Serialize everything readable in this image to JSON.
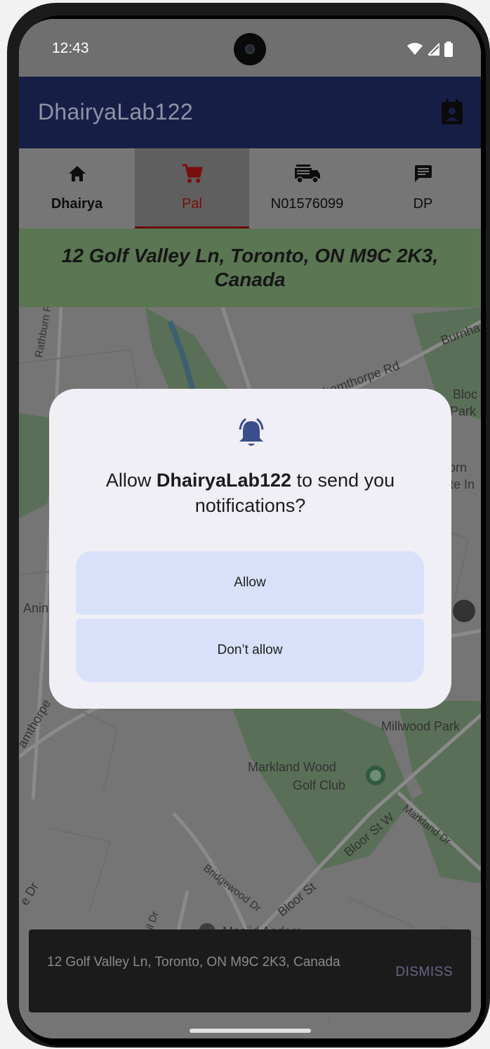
{
  "status_bar": {
    "time": "12:43"
  },
  "app_bar": {
    "title": "DhairyaLab122",
    "action_icon": "calendar-person-icon"
  },
  "tabs": [
    {
      "label": "Dhairya",
      "icon": "home-icon",
      "selected": false
    },
    {
      "label": "Pal",
      "icon": "shopping-cart-icon",
      "selected": true
    },
    {
      "label": "N01576099",
      "icon": "fire-truck-icon",
      "selected": false
    },
    {
      "label": "DP",
      "icon": "chat-icon",
      "selected": false
    }
  ],
  "address_banner": {
    "text": "12 Golf Valley Ln, Toronto, ON M9C 2K3, Canada"
  },
  "map": {
    "labels": {
      "rathburn": "Rathburn Rd E",
      "burnhamthorpe_top": "Burnhamthorpe Rd",
      "burnha": "Burnha",
      "bloor_park": "Bloc",
      "park": "Park",
      "orn": "orn",
      "ite_in": "ite In",
      "anim": "Anin",
      "millwood": "Millwood Park",
      "amthorpe": "amthorpe",
      "markland_wood": "Markland Wood",
      "golf_club": "Golf Club",
      "bloor_st_w": "Bloor St W",
      "markland_dr": "Markland Dr",
      "bridgewood": "Bridgewood Dr",
      "bloor_st": "Bloor St",
      "e_dr": "e Dr",
      "rail_dr": "rail Dr",
      "masjid": "Masjid Aadam"
    }
  },
  "dialog": {
    "icon": "bell-ringing-icon",
    "title_prefix": "Allow ",
    "title_app": "DhairyaLab122",
    "title_suffix": " to send you notifications?",
    "allow_label": "Allow",
    "deny_label": "Don’t allow"
  },
  "snackbar": {
    "message": "12 Golf Valley Ln, Toronto, ON M9C 2K3, Canada",
    "action": "DISMISS"
  },
  "colors": {
    "app_bar": "#171e46",
    "selected_tab_accent": "#6b0a0a",
    "banner": "#5b7652",
    "dialog_bg": "#f1eff6",
    "dialog_button": "#d9e1fa",
    "dialog_icon": "#3b4e8c"
  }
}
